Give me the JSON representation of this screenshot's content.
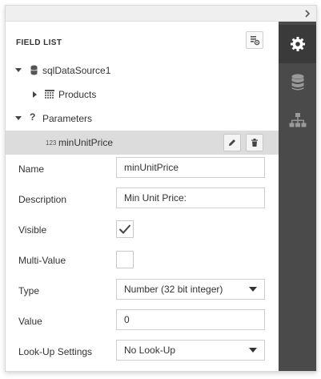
{
  "field_list": {
    "title": "FIELD LIST"
  },
  "tree": {
    "datasource": {
      "label": "sqlDataSource1"
    },
    "products": {
      "label": "Products"
    },
    "parameters": {
      "label": "Parameters"
    },
    "parameter": {
      "type_badge": "123",
      "label": "minUnitPrice"
    }
  },
  "properties": {
    "name": {
      "label": "Name",
      "value": "minUnitPrice"
    },
    "description": {
      "label": "Description",
      "value": "Min Unit Price:"
    },
    "visible": {
      "label": "Visible",
      "checked": true
    },
    "multi_value": {
      "label": "Multi-Value",
      "checked": false
    },
    "type": {
      "label": "Type",
      "value": "Number (32 bit integer)"
    },
    "value": {
      "label": "Value",
      "value": "0"
    },
    "lookup": {
      "label": "Look-Up Settings",
      "value": "No Look-Up"
    }
  },
  "sidebar": {
    "tabs": [
      {
        "icon": "gear-icon",
        "active": true
      },
      {
        "icon": "database-icon",
        "active": false
      },
      {
        "icon": "hierarchy-icon",
        "active": false
      }
    ]
  },
  "colors": {
    "sidebar_bg": "#4a4a4a",
    "sidebar_active": "#3a3a3a",
    "selected_row": "#dcdcdc"
  }
}
